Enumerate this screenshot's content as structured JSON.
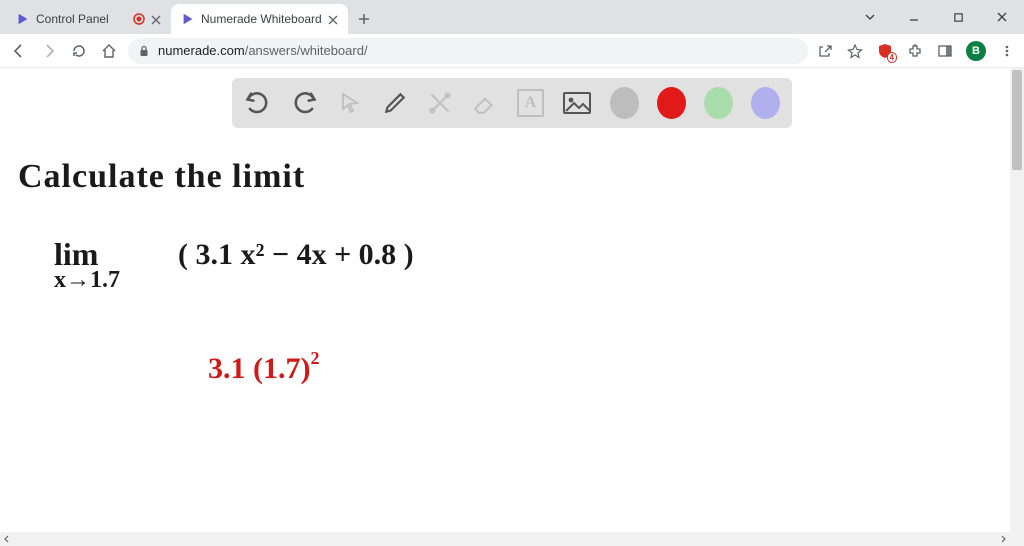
{
  "tabs": [
    {
      "title": "Control Panel",
      "recording": true
    },
    {
      "title": "Numerade Whiteboard",
      "recording": false
    }
  ],
  "url": {
    "host": "numerade.com",
    "path": "/answers/whiteboard/"
  },
  "extensions": {
    "shield_badge": "4"
  },
  "profile": {
    "initial": "B"
  },
  "wb_toolbar": {
    "text_tool_label": "A",
    "swatches": [
      "#bdbdbd",
      "#e11919",
      "#a9dcab",
      "#b0b0ef"
    ]
  },
  "handwriting": {
    "line1": "Calculate the limit",
    "lim": "lim",
    "lim_sub": "x→1.7",
    "expr": "( 3.1 x² − 4x + 0.8 )",
    "red": "3.1 (1.7)",
    "red_sup": "2"
  }
}
